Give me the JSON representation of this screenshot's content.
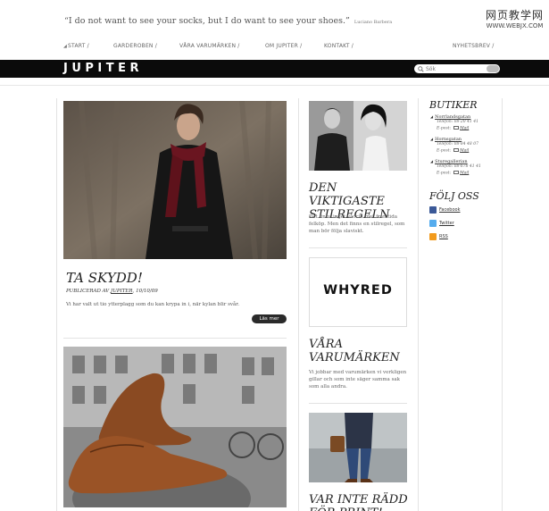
{
  "quote": {
    "text": "“I do not want to see your socks, but I do want to see your shoes.”",
    "author": "Luciano Barbera"
  },
  "watermark": {
    "line1": "网页教学网",
    "line2": "WWW.WEBJX.COM"
  },
  "nav": {
    "items": [
      {
        "label": "START /",
        "active": true
      },
      {
        "label": "GARDEROBEN /"
      },
      {
        "label": "VÅRA VARUMÄRKEN /"
      },
      {
        "label": "OM JUPITER /"
      },
      {
        "label": "KONTAKT /"
      },
      {
        "label": "NYHETSBREV /"
      }
    ]
  },
  "header": {
    "logo": "JUPITER",
    "search_placeholder": "Sök"
  },
  "posts": [
    {
      "title": "TA SKYDD!",
      "meta_prefix": "PUBLICERAD AV",
      "author": "JUPITER",
      "date": ", 10/10/09",
      "excerpt": "Vi har valt ut tio ytterplagg som du kan krypa in i, när kylan blir svår.",
      "read_more": "Läs mer"
    }
  ],
  "middle": {
    "feature1": {
      "title": "DEN VIKTIGASTE STILREGELN",
      "text": "Det finns inget vaccin mot framtida felköp. Men det finns en stilregel, som man bör följa slaviskt."
    },
    "brand_logo": "WHYRED",
    "feature2": {
      "title": "VÅRA VARUMÄRKEN",
      "text": "Vi jobbar med varumärken vi verkligen gillar och som inte säger samma sak som alla andra."
    },
    "feature3": {
      "title": "VAR INTE RÄDD FÖR PRINT!"
    }
  },
  "sidebar": {
    "stores_title": "BUTIKER",
    "stores": [
      {
        "name": "Norrlandsgatan",
        "phone_label": "Telefon:",
        "phone": "08-20 41 41",
        "email_label": "E-post:",
        "email": "Mail"
      },
      {
        "name": "Hornsgatan",
        "phone_label": "Telefon:",
        "phone": "08-84 48 07",
        "email_label": "E-post:",
        "email": "Mail"
      },
      {
        "name": "Sturegallerian",
        "phone_label": "Telefon:",
        "phone": "08-678 41 41",
        "email_label": "E-post:",
        "email": "Mail"
      }
    ],
    "follow_title": "FÖLJ OSS",
    "follow": [
      {
        "label": "Facebook",
        "color": "#3b5998"
      },
      {
        "label": "Twitter",
        "color": "#55acee"
      },
      {
        "label": "RSS",
        "color": "#f29b1d"
      }
    ]
  }
}
